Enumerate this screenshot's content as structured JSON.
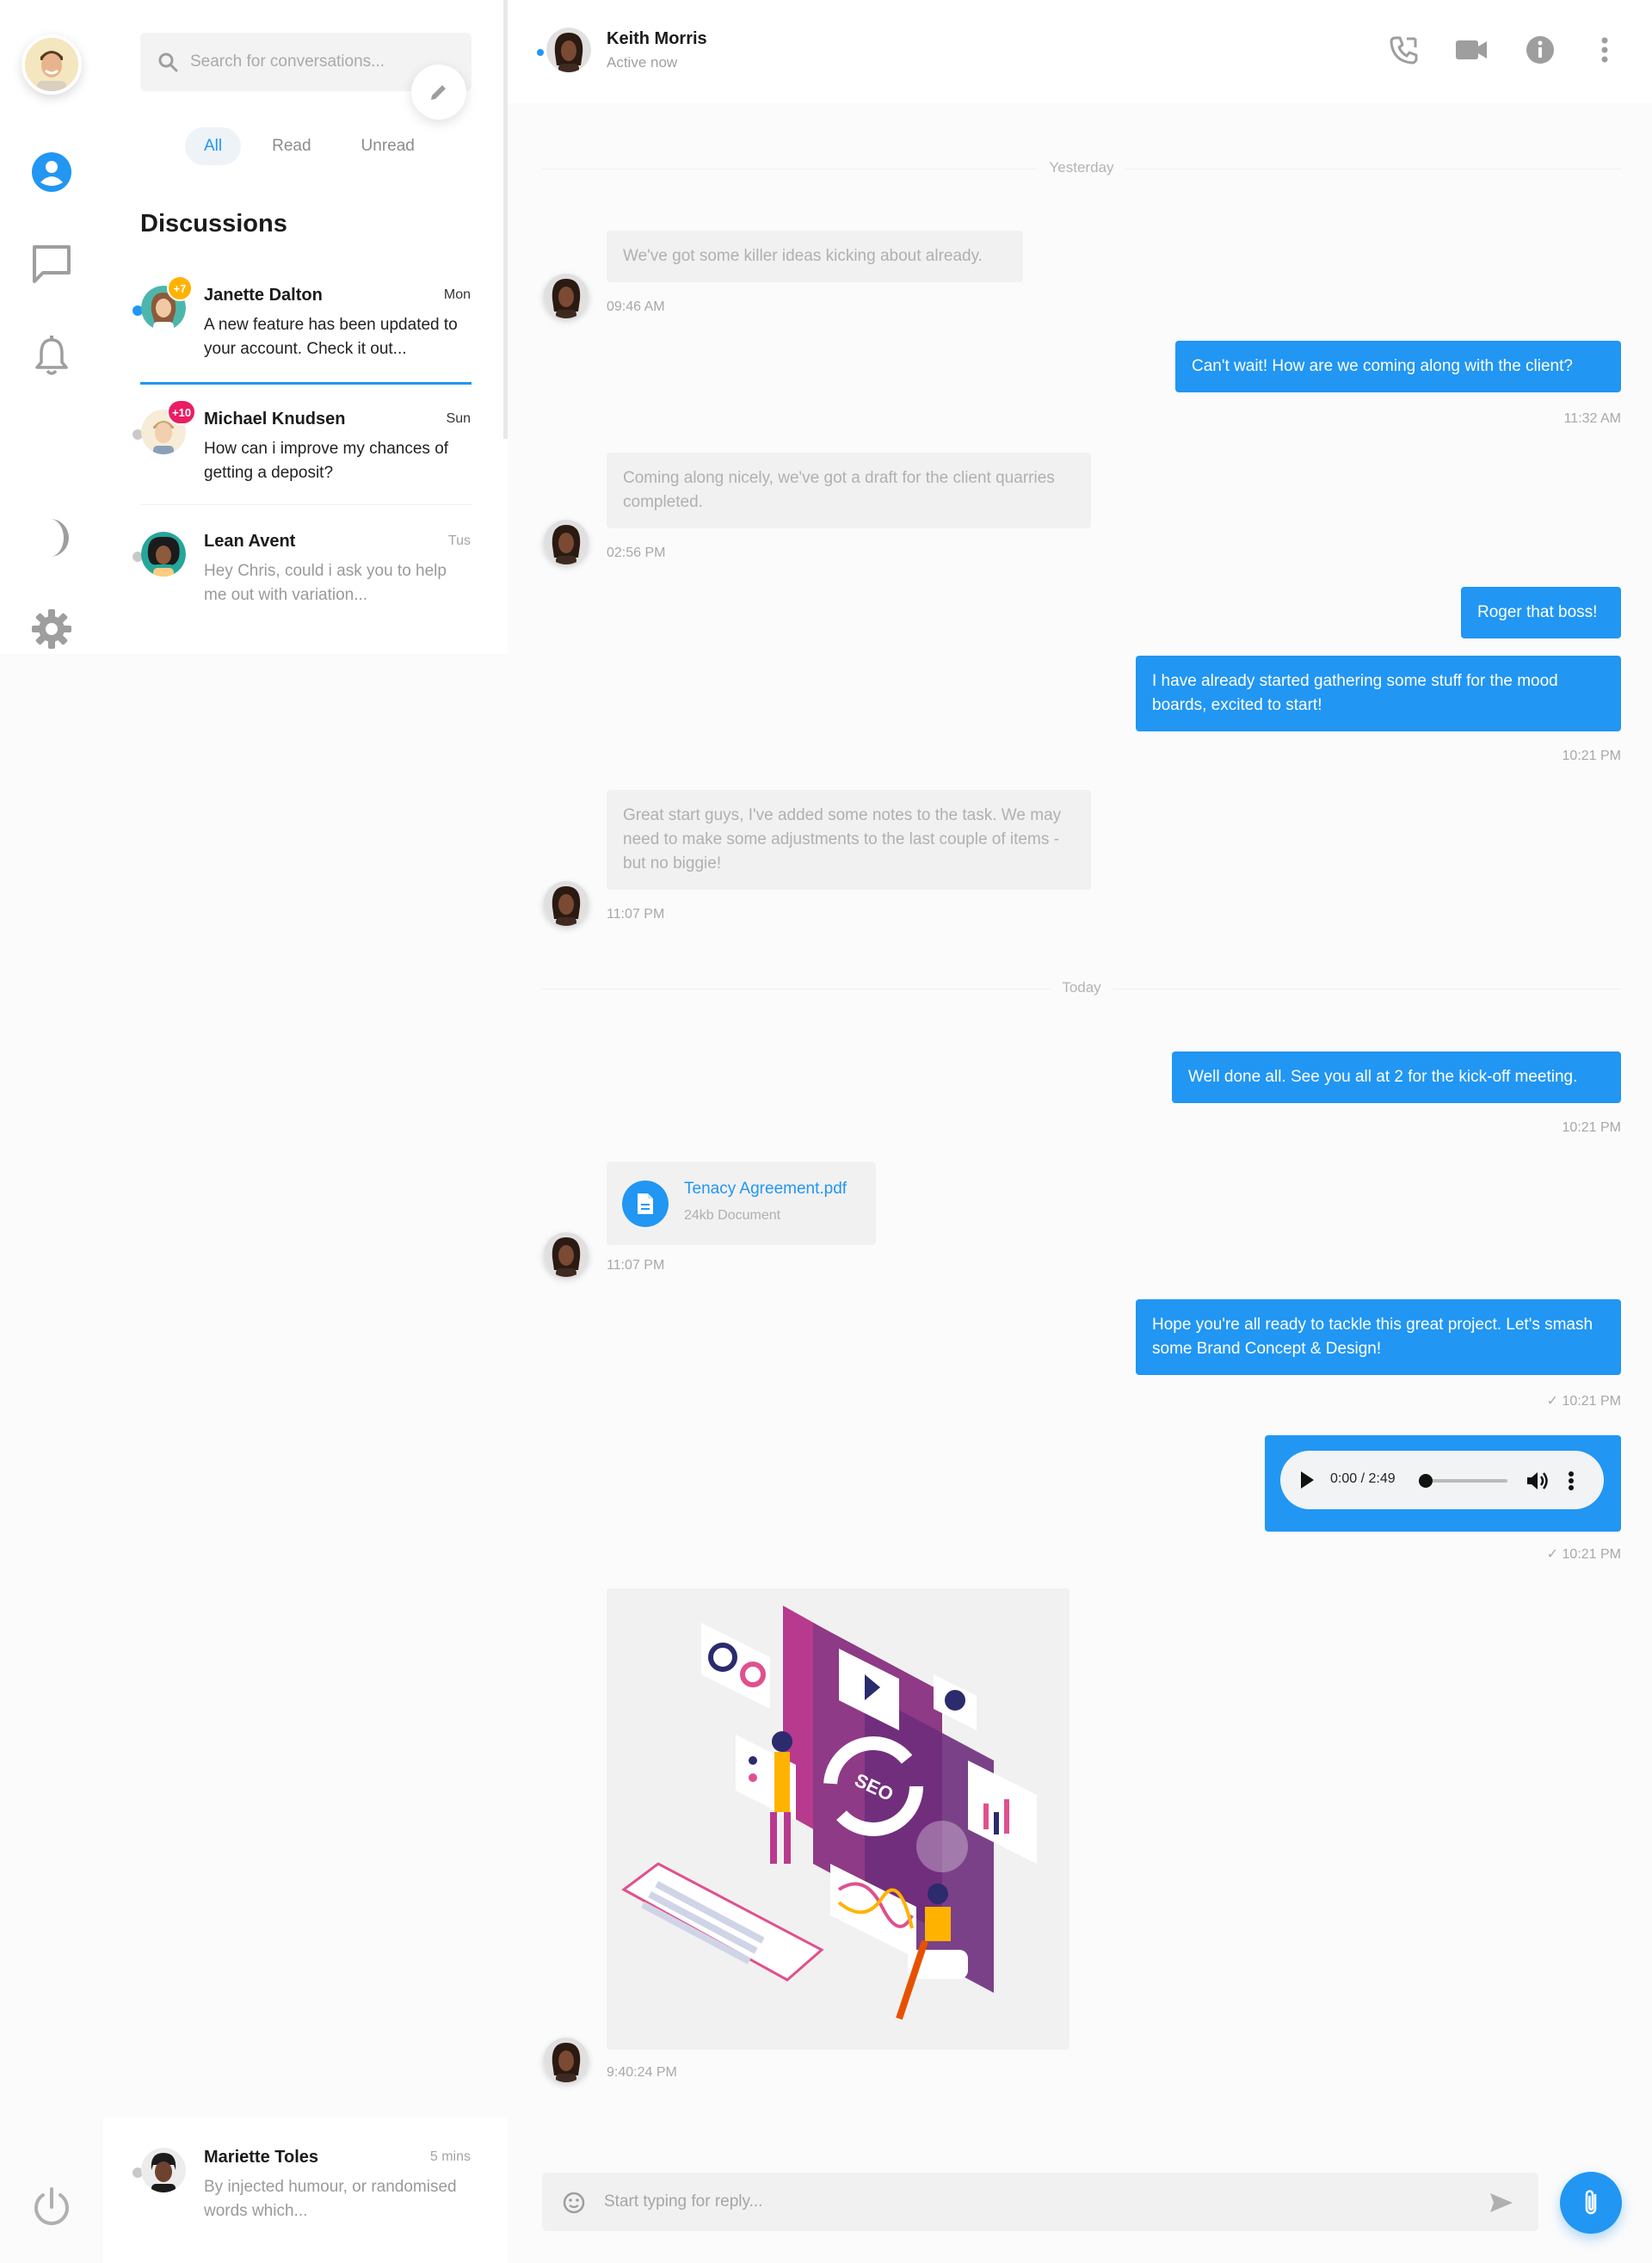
{
  "colors": {
    "accent": "#2196f3",
    "badge_orange": "#ffb300",
    "badge_pink": "#e91e63",
    "offline": "#c9c9c9"
  },
  "rail": {
    "icons": [
      "user-circle-icon",
      "chat-bubble-icon",
      "bell-icon",
      "moon-icon",
      "gear-icon",
      "power-icon"
    ]
  },
  "search": {
    "placeholder": "Search for conversations..."
  },
  "filters": [
    "All",
    "Read",
    "Unread"
  ],
  "discussions_title": "Discussions",
  "conversations": [
    {
      "name": "Janette Dalton",
      "time": "Mon",
      "preview": "A new feature has been updated to your account. Check it out...",
      "badge": "+7",
      "online": true,
      "unread": true
    },
    {
      "name": "Michael Knudsen",
      "time": "Sun",
      "preview": "How can i improve my chances of getting a deposit?",
      "badge": "+10",
      "online": false,
      "unread": true
    },
    {
      "name": "Lean Avent",
      "time": "Tus",
      "preview": "Hey Chris, could i ask you to help me out with variation...",
      "online": false,
      "unread": false
    },
    {
      "name": "Mariette Toles",
      "time": "5 mins",
      "preview": "By injected humour, or randomised words which...",
      "online": false,
      "unread": false
    }
  ],
  "chat": {
    "contact_name": "Keith Morris",
    "contact_status": "Active now",
    "header_icons": [
      "phone-icon",
      "video-camera-icon",
      "info-icon",
      "more-vertical-icon"
    ],
    "day_labels": [
      "Yesterday",
      "Today"
    ],
    "messages": [
      {
        "dir": "in",
        "text": "We've got some killer ideas kicking about already.",
        "time": "09:46 AM"
      },
      {
        "dir": "out",
        "text": "Can't wait! How are we coming along with the client?",
        "time": "11:32 AM"
      },
      {
        "dir": "in",
        "text": "Coming along nicely, we've got a draft for the client quarries completed.",
        "time": "02:56 PM"
      },
      {
        "dir": "out",
        "text": "Roger that boss!"
      },
      {
        "dir": "out",
        "text": "I have already started gathering some stuff for the mood boards, excited to start!",
        "time": "10:21 PM"
      },
      {
        "dir": "in",
        "text": "Great start guys, I've added some notes to the task. We may need to make some adjustments to the last couple of items - but no biggie!",
        "time": "11:07 PM"
      },
      {
        "dir": "out",
        "text": "Well done all. See you all at 2 for the kick-off meeting.",
        "time": "10:21 PM"
      },
      {
        "dir": "in",
        "file_name": "Tenacy Agreement.pdf",
        "file_size": "24kb Document",
        "time": "11:07 PM"
      },
      {
        "dir": "out",
        "text": "Hope you're all ready to tackle this great project. Let's smash some Brand Concept & Design!",
        "time": "10:21 PM",
        "status": "✓"
      },
      {
        "dir": "out",
        "audio_time": "0:00 / 2:49",
        "time": "10:21 PM",
        "status": "✓",
        "progress": 0
      },
      {
        "dir": "in",
        "image_label": "SEO",
        "time": "9:40:24 PM"
      }
    ],
    "composer_placeholder": "Start typing for reply..."
  }
}
